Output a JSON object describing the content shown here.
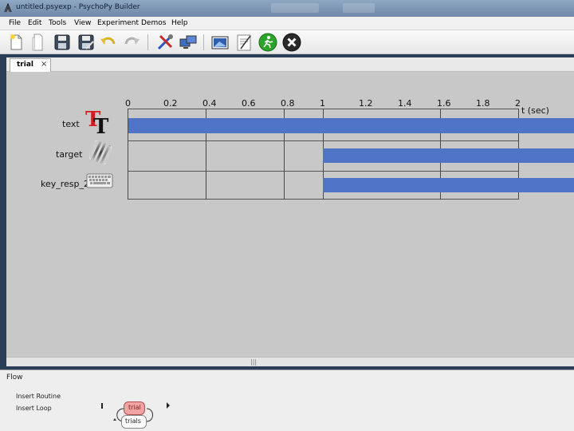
{
  "window": {
    "title": "untitled.psyexp - PsychoPy Builder"
  },
  "menu": {
    "items": [
      {
        "label": "File"
      },
      {
        "label": "Edit"
      },
      {
        "label": "Tools"
      },
      {
        "label": "View"
      },
      {
        "label": "Experiment"
      },
      {
        "label": "Demos"
      },
      {
        "label": "Help"
      }
    ]
  },
  "toolbar": {
    "buttons": [
      {
        "icon": "new-file-icon"
      },
      {
        "icon": "open-file-icon"
      },
      {
        "icon": "save-icon"
      },
      {
        "icon": "save-as-icon"
      },
      {
        "icon": "undo-icon"
      },
      {
        "icon": "redo-icon"
      },
      {
        "icon": "preferences-icon"
      },
      {
        "icon": "monitor-center-icon"
      },
      {
        "icon": "experiment-settings-icon"
      },
      {
        "icon": "compile-script-icon"
      },
      {
        "icon": "run-icon"
      },
      {
        "icon": "stop-icon"
      }
    ]
  },
  "routine": {
    "tab_label": "trial",
    "tab_close": "×",
    "timeline": {
      "ticks": [
        "0",
        "0.2",
        "0.4",
        "0.6",
        "0.8",
        "1",
        "1.2",
        "1.4",
        "1.6",
        "1.8",
        "2"
      ],
      "unit_label": "t (sec)"
    },
    "components": [
      {
        "name": "text",
        "icon": "text-component-icon",
        "start": 0,
        "stop": null
      },
      {
        "name": "target",
        "icon": "grating-component-icon",
        "start": 1,
        "stop": null
      },
      {
        "name": "key_resp_2",
        "icon": "keyboard-component-icon",
        "start": 1,
        "stop": null
      }
    ],
    "bar_color": "#4f74c6"
  },
  "scroll": {
    "grip": "|||"
  },
  "flow": {
    "title": "Flow",
    "insert_routine": "Insert Routine",
    "insert_loop": "Insert Loop",
    "routine_name": "trial",
    "loop_name": "trials",
    "routine_color": "#f2a3a3"
  }
}
